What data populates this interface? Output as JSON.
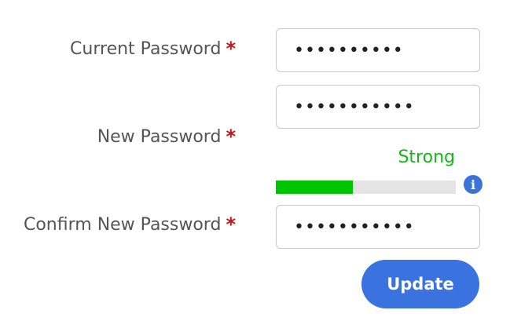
{
  "form": {
    "current_password": {
      "label": "Current Password",
      "required_mark": "*",
      "value": "••••••••••"
    },
    "new_password": {
      "label": "New Password",
      "required_mark": "*",
      "value": "•••••••••••"
    },
    "strength": {
      "label": "Strength",
      "text": "Strong",
      "fill_fraction": 0.43,
      "fill_color": "#00c400",
      "text_color": "#11bb11"
    },
    "info_icon": "info-icon",
    "info_glyph": "i",
    "confirm_password": {
      "label": "Confirm New Password",
      "required_mark": "*",
      "value": "•••••••••••"
    },
    "update_label": "Update",
    "accent_color": "#3a72df"
  }
}
